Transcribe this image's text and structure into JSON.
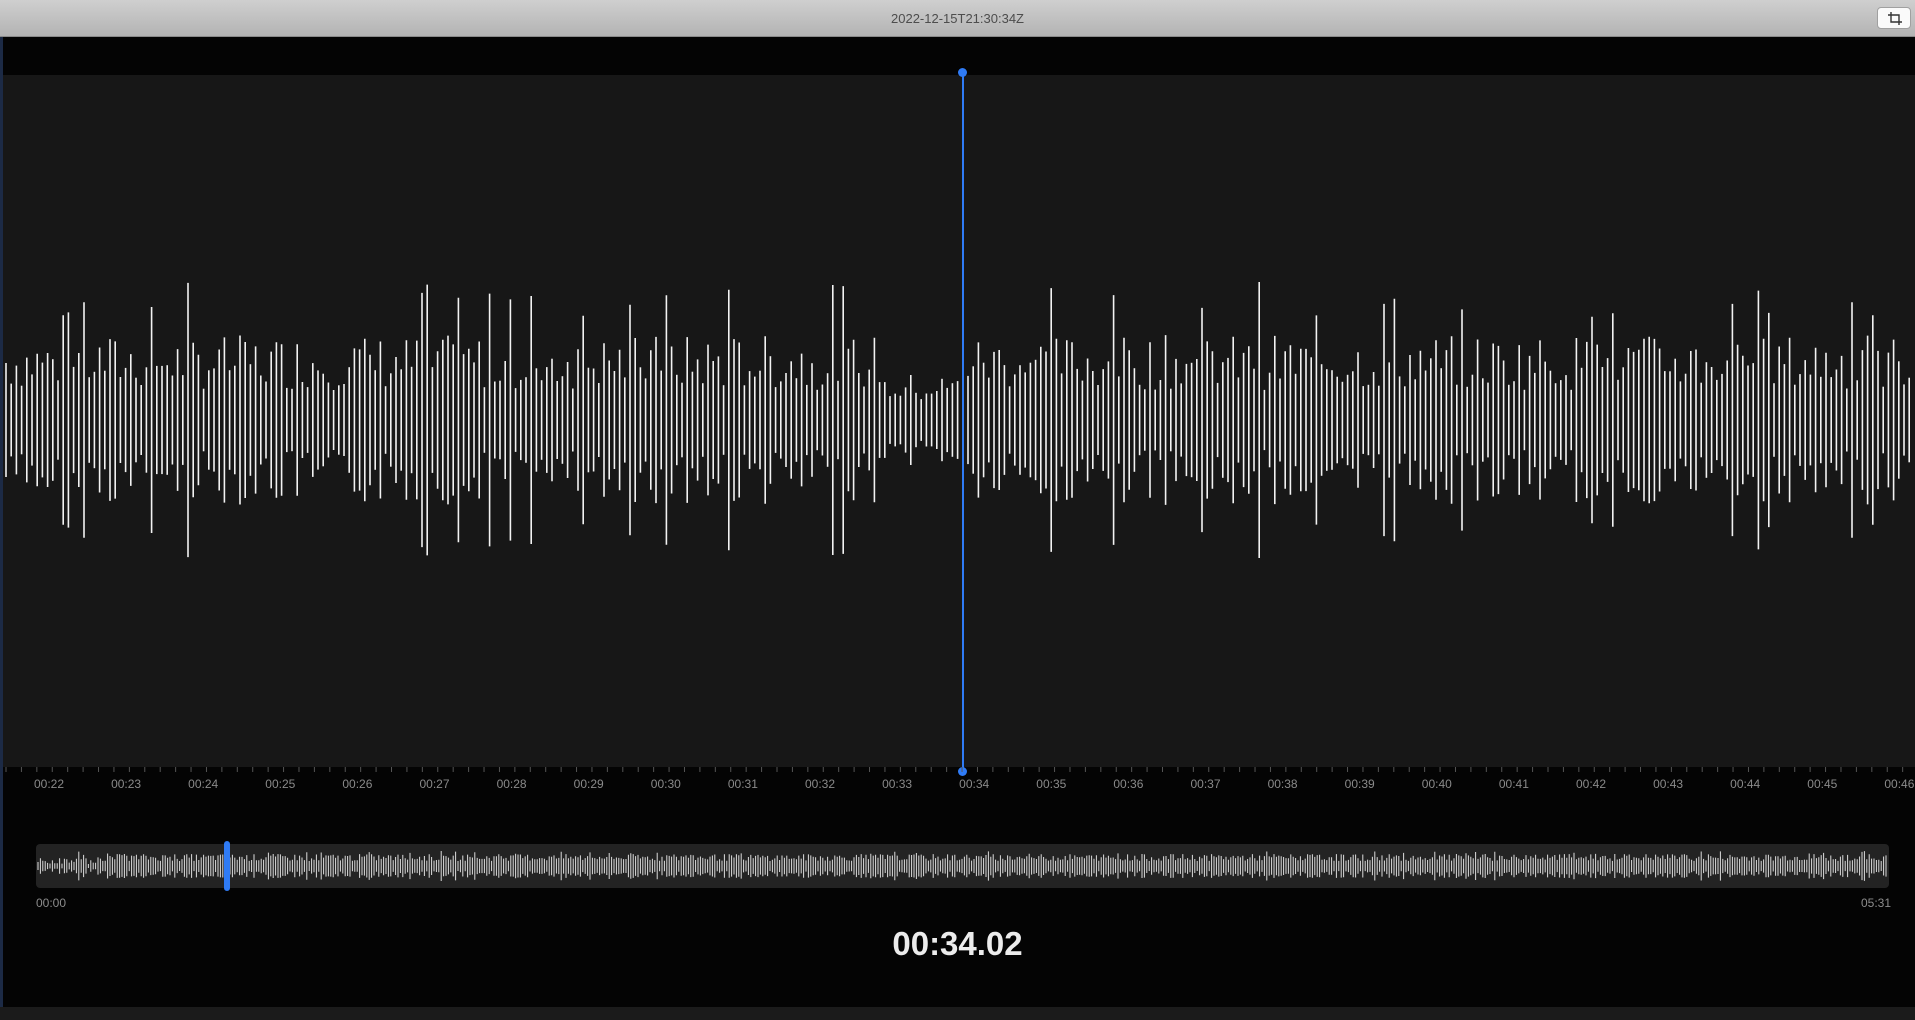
{
  "window": {
    "title": "2022-12-15T21:30:34Z",
    "crop_icon": "crop-icon"
  },
  "colors": {
    "accent": "#2f7bf5",
    "waveform": "#f2f2f2",
    "editor_background": "#171717",
    "app_background": "#040404"
  },
  "timeline": {
    "ticks": [
      "00:22",
      "00:23",
      "00:24",
      "00:25",
      "00:26",
      "00:27",
      "00:28",
      "00:29",
      "00:30",
      "00:31",
      "00:32",
      "00:33",
      "00:34",
      "00:35",
      "00:36",
      "00:37",
      "00:38",
      "00:39",
      "00:40",
      "00:41",
      "00:42",
      "00:43",
      "00:44",
      "00:45",
      "00:46"
    ]
  },
  "overview": {
    "start_label": "00:00",
    "end_label": "05:31"
  },
  "playback": {
    "current_time": "00:34.02"
  }
}
